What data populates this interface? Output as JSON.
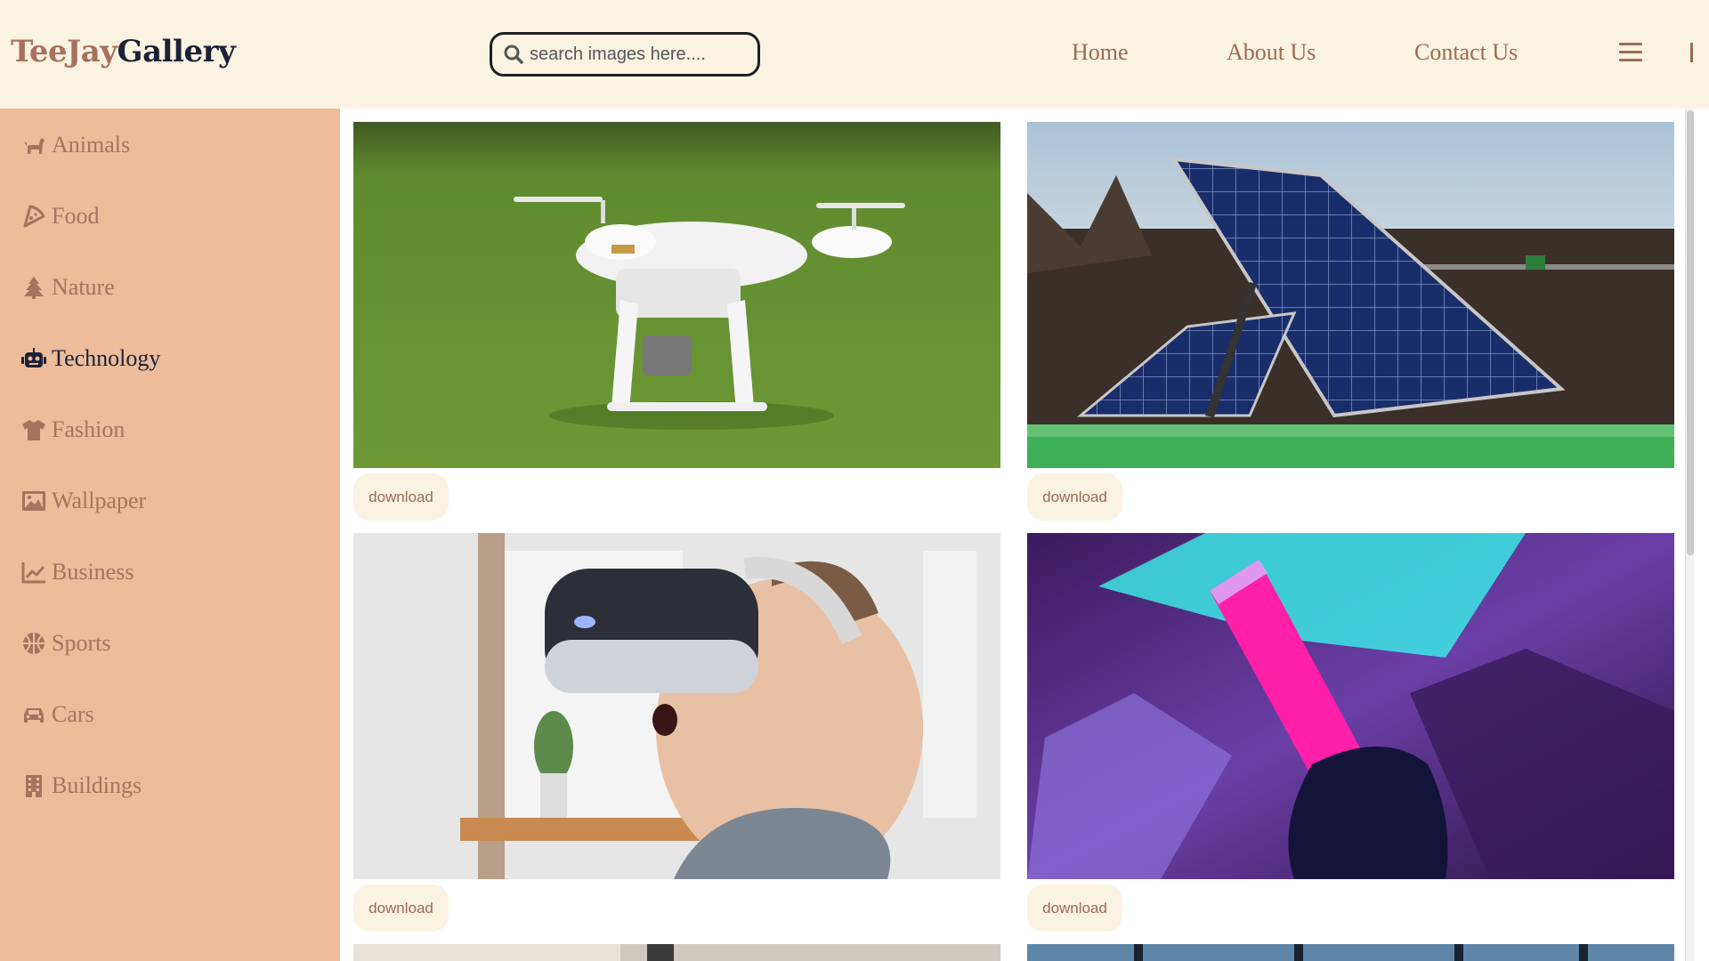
{
  "logo": {
    "part1": "TeeJay",
    "part2": "Gallery"
  },
  "search": {
    "placeholder": "search images here...."
  },
  "nav": {
    "home": "Home",
    "about": "About Us",
    "contact": "Contact Us"
  },
  "sidebar": {
    "items": [
      {
        "label": "Animals",
        "icon": "dog-icon"
      },
      {
        "label": "Food",
        "icon": "pizza-slice-icon"
      },
      {
        "label": "Nature",
        "icon": "tree-icon"
      },
      {
        "label": "Technology",
        "icon": "robot-icon",
        "active": true
      },
      {
        "label": "Fashion",
        "icon": "shirt-icon"
      },
      {
        "label": "Wallpaper",
        "icon": "image-icon"
      },
      {
        "label": "Business",
        "icon": "chart-line-icon"
      },
      {
        "label": "Sports",
        "icon": "basketball-icon"
      },
      {
        "label": "Cars",
        "icon": "car-icon"
      },
      {
        "label": "Buildings",
        "icon": "building-icon"
      }
    ]
  },
  "gallery": {
    "download_label": "download",
    "images": [
      {
        "subject": "drone-on-grass"
      },
      {
        "subject": "solar-panels"
      },
      {
        "subject": "child-vr-headset"
      },
      {
        "subject": "neon-light-tube"
      }
    ]
  },
  "colors": {
    "header_bg": "#fbf3e1",
    "sidebar_bg": "#ecbc9b",
    "accent": "#9b6a55",
    "dark": "#1d2136"
  }
}
